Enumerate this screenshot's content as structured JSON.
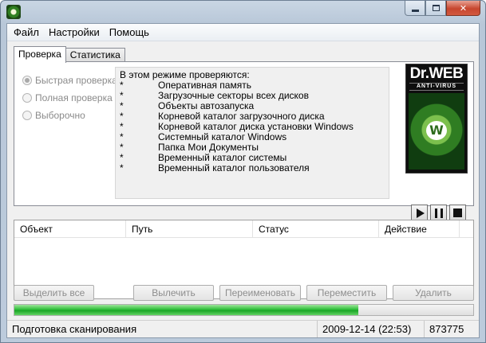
{
  "window": {
    "minimize_icon": "minimize-icon",
    "maximize_icon": "maximize-icon",
    "close_icon": "close-icon",
    "close_glyph": "✕"
  },
  "menu": [
    "Файл",
    "Настройки",
    "Помощь"
  ],
  "tabs": [
    "Проверка",
    "Статистика"
  ],
  "scan_modes": [
    {
      "label": "Быстрая проверка",
      "checked": true
    },
    {
      "label": "Полная проверка",
      "checked": false
    },
    {
      "label": "Выборочно",
      "checked": false
    }
  ],
  "description": {
    "title": "В этом режиме проверяются:",
    "bullet": "*",
    "items": [
      "Оперативная память",
      "Загрузочные секторы всех дисков",
      "Объекты автозапуска",
      "Корневой каталог загрузочного диска",
      "Корневой каталог диска установки Windows",
      "Системный каталог Windows",
      "Папка Мои Документы",
      "Временный каталог системы",
      "Временный каталог пользователя"
    ]
  },
  "logo": {
    "brand": "Dr.WEB",
    "subtitle": "ANTI-VIRUS",
    "mark": "W"
  },
  "controls": {
    "play_icon": "play-icon",
    "pause_icon": "pause-icon",
    "stop_icon": "stop-icon"
  },
  "results_columns": [
    "Объект",
    "Путь",
    "Статус",
    "Действие"
  ],
  "actions": [
    "Выделить все",
    "Вылечить",
    "Переименовать",
    "Переместить",
    "Удалить"
  ],
  "progress": {
    "fraction": 0.75
  },
  "status": {
    "message": "Подготовка сканирования",
    "datetime": "2009-12-14 (22:53)",
    "count": "873775"
  },
  "colors": {
    "accent_green": "#2fbf3a",
    "close_red": "#c7462e"
  }
}
